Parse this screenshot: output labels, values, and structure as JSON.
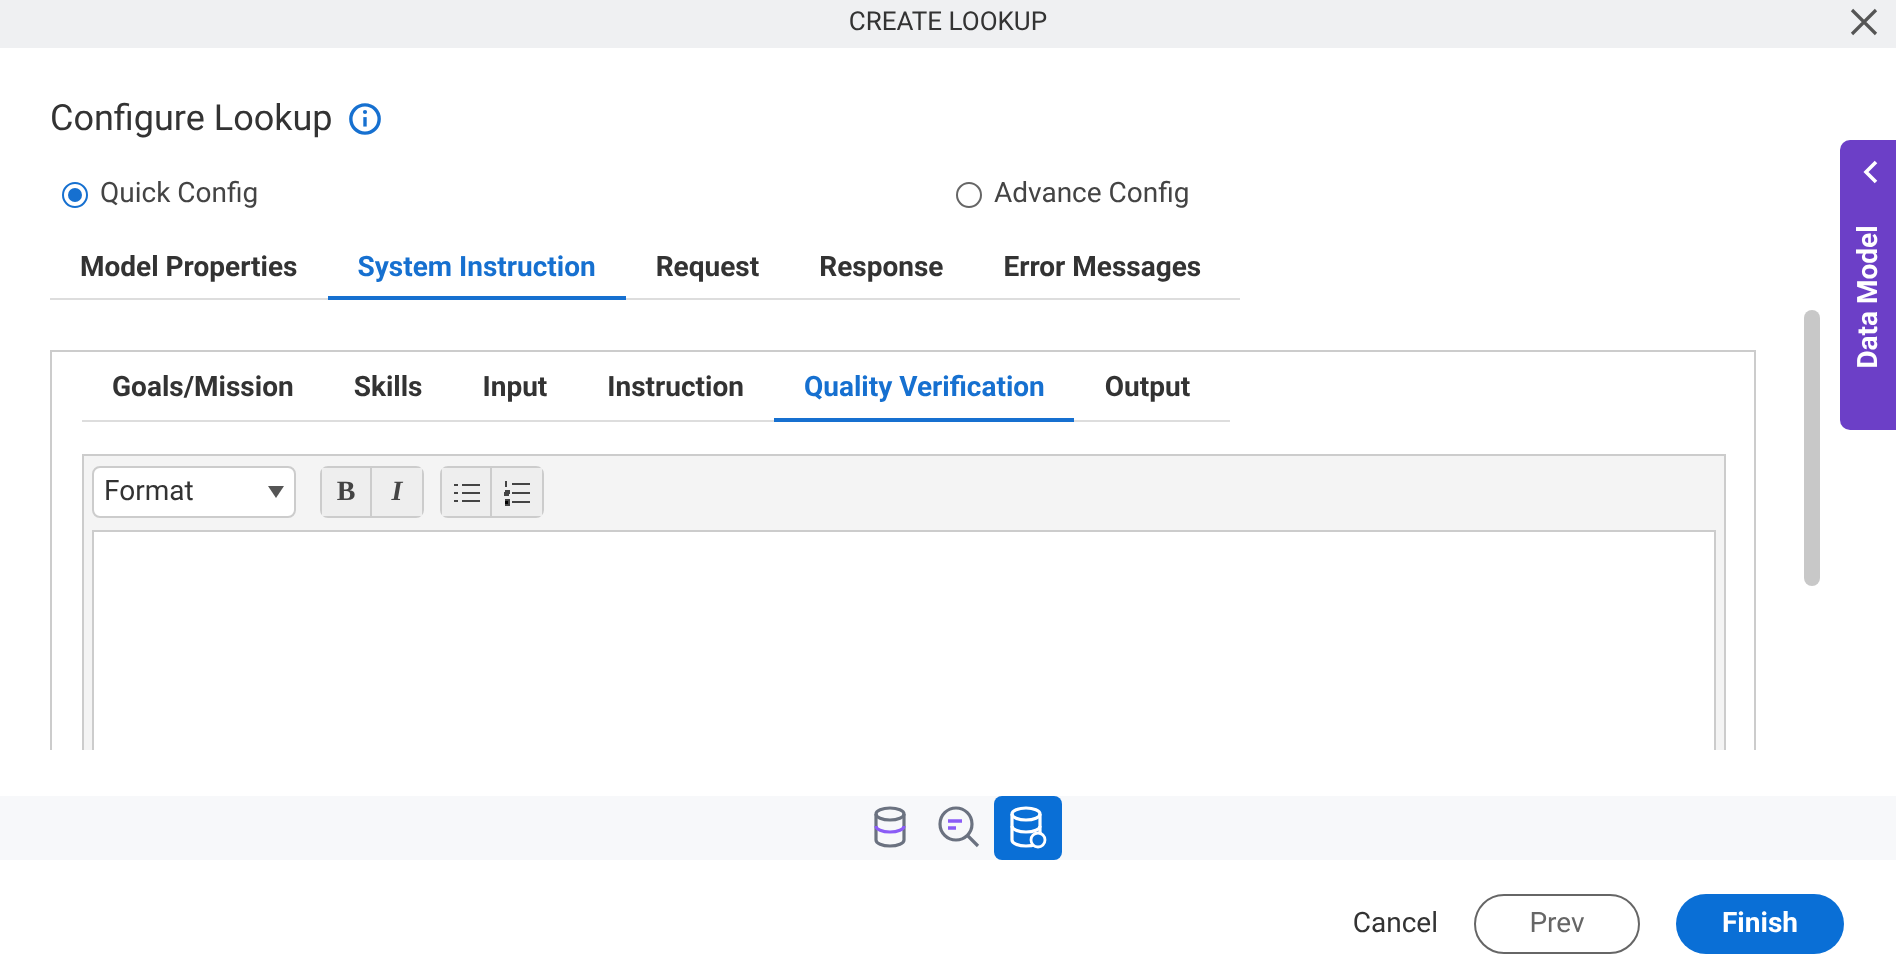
{
  "window": {
    "title": "CREATE LOOKUP"
  },
  "heading": "Configure Lookup",
  "config_options": [
    {
      "label": "Quick Config",
      "selected": true
    },
    {
      "label": "Advance Config",
      "selected": false
    }
  ],
  "tabs": [
    {
      "label": "Model Properties",
      "selected": false
    },
    {
      "label": "System Instruction",
      "selected": true
    },
    {
      "label": "Request",
      "selected": false
    },
    {
      "label": "Response",
      "selected": false
    },
    {
      "label": "Error Messages",
      "selected": false
    }
  ],
  "sub_tabs": [
    {
      "label": "Goals/Mission",
      "selected": false
    },
    {
      "label": "Skills",
      "selected": false
    },
    {
      "label": "Input",
      "selected": false
    },
    {
      "label": "Instruction",
      "selected": false
    },
    {
      "label": "Quality Verification",
      "selected": true
    },
    {
      "label": "Output",
      "selected": false
    }
  ],
  "editor": {
    "format_select": "Format",
    "bold": "B",
    "italic": "I"
  },
  "side_panel": {
    "label": "Data Model"
  },
  "bottom_icons": [
    {
      "kind": "database",
      "selected": false
    },
    {
      "kind": "search",
      "selected": false
    },
    {
      "kind": "database-settings",
      "selected": true
    }
  ],
  "buttons": [
    {
      "kind": "text",
      "label": "Cancel"
    },
    {
      "kind": "outline",
      "label": "Prev"
    },
    {
      "kind": "primary",
      "label": "Finish"
    }
  ]
}
